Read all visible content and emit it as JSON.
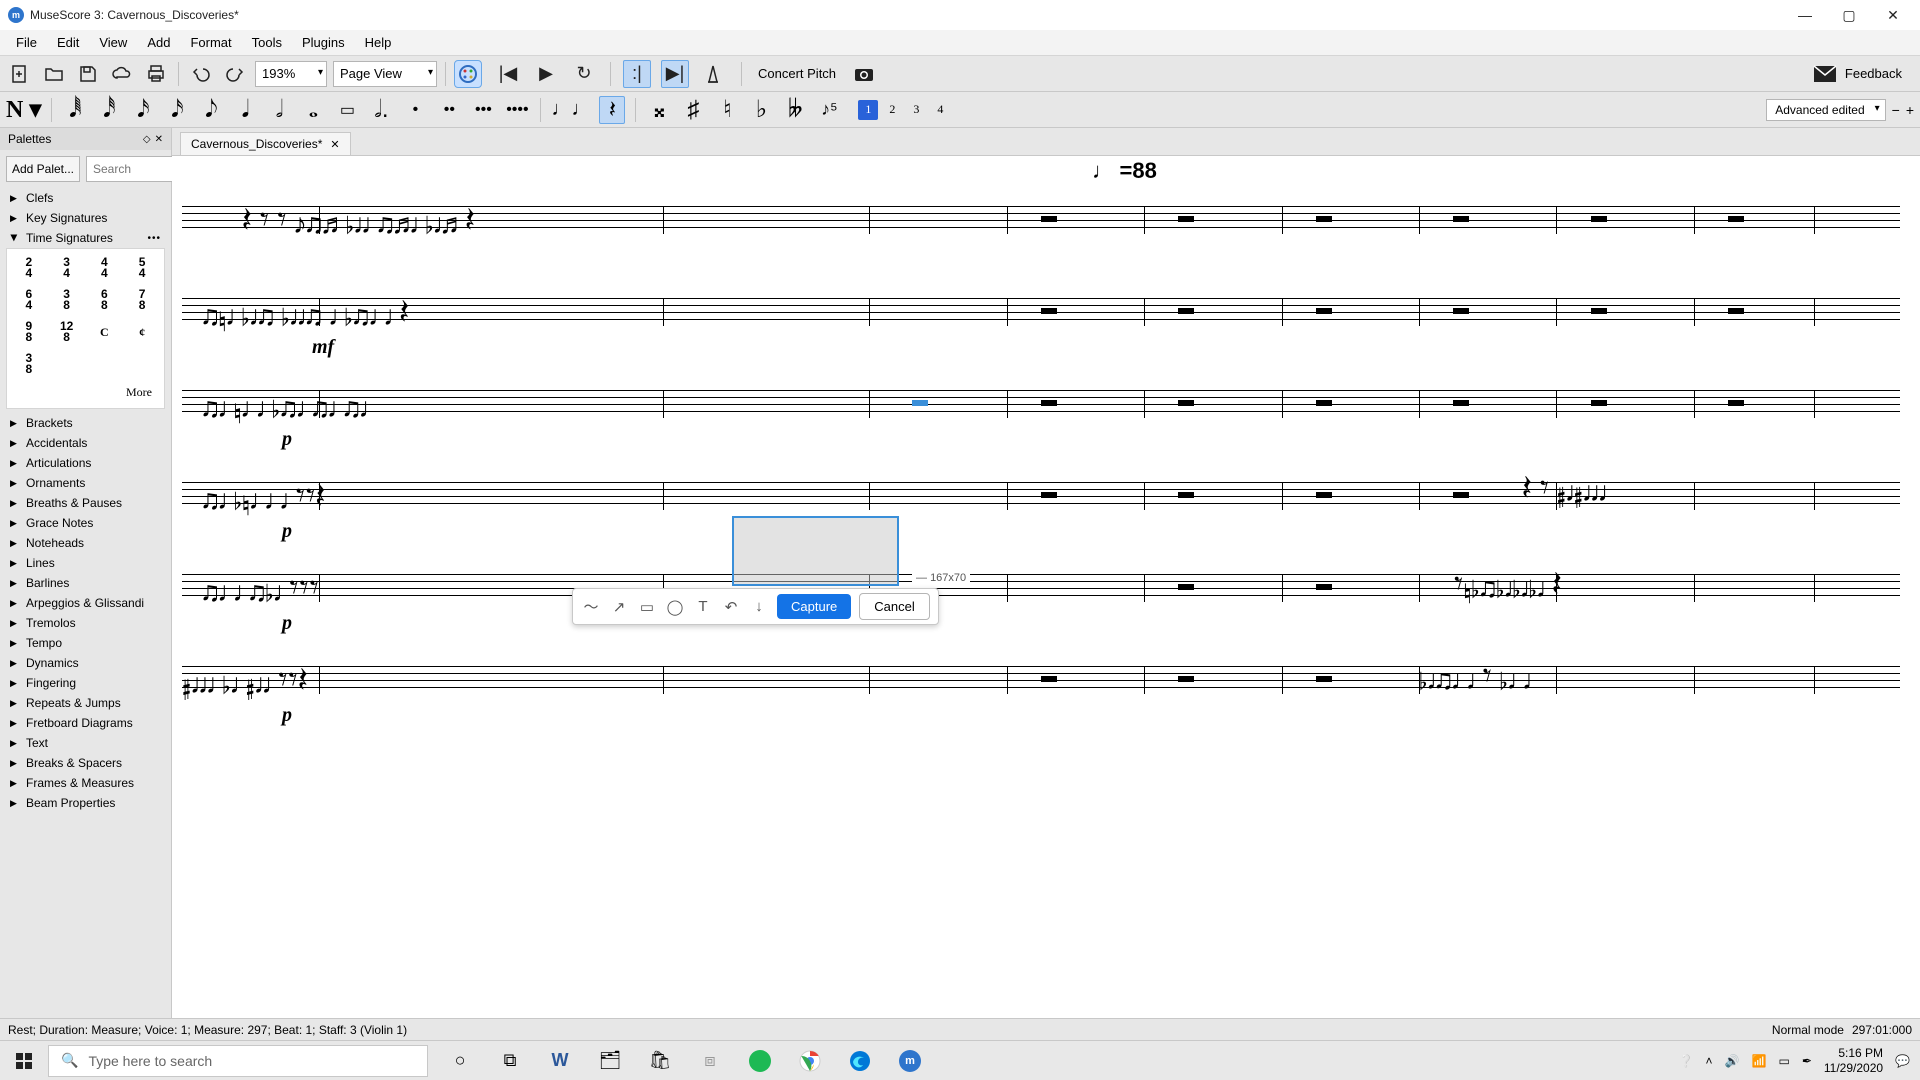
{
  "window": {
    "title": "MuseScore 3: Cavernous_Discoveries*"
  },
  "menu": [
    "File",
    "Edit",
    "View",
    "Add",
    "Format",
    "Tools",
    "Plugins",
    "Help"
  ],
  "toolbar": {
    "zoom": "193%",
    "view_mode": "Page View",
    "concert_pitch": "Concert Pitch",
    "feedback": "Feedback"
  },
  "note_toolbar": {
    "voices": [
      "1",
      "2",
      "3",
      "4"
    ],
    "workspace": "Advanced edited"
  },
  "palettes": {
    "header": "Palettes",
    "add_button": "Add Palet...",
    "search_placeholder": "Search",
    "items": [
      {
        "label": "Clefs",
        "expanded": false
      },
      {
        "label": "Key Signatures",
        "expanded": false
      },
      {
        "label": "Time Signatures",
        "expanded": true
      }
    ],
    "time_sigs": [
      "2/4",
      "3/4",
      "4/4",
      "5/4",
      "6/4",
      "3/8",
      "6/8",
      "7/8",
      "9/8",
      "12/8",
      "C",
      "¢",
      "3/8"
    ],
    "time_sig_more": "More",
    "items_after": [
      "Brackets",
      "Accidentals",
      "Articulations",
      "Ornaments",
      "Breaths & Pauses",
      "Grace Notes",
      "Noteheads",
      "Lines",
      "Barlines",
      "Arpeggios & Glissandi",
      "Tremolos",
      "Tempo",
      "Dynamics",
      "Fingering",
      "Repeats & Jumps",
      "Fretboard Diagrams",
      "Text",
      "Breaks & Spacers",
      "Frames & Measures",
      "Beam Properties"
    ]
  },
  "tab": {
    "label": "Cavernous_Discoveries*"
  },
  "score": {
    "tempo_mark": "=88",
    "dynamics": [
      "mf",
      "p",
      "p",
      "p",
      "p"
    ]
  },
  "capture": {
    "capture_label": "Capture",
    "cancel_label": "Cancel",
    "dims": "167x70"
  },
  "status": {
    "left": "Rest; Duration: Measure; Voice: 1;  Measure: 297; Beat: 1; Staff: 3 (Violin 1)",
    "mode": "Normal mode",
    "position": "297:01:000"
  },
  "taskbar": {
    "search_placeholder": "Type here to search",
    "time": "5:16 PM",
    "date": "11/29/2020"
  }
}
